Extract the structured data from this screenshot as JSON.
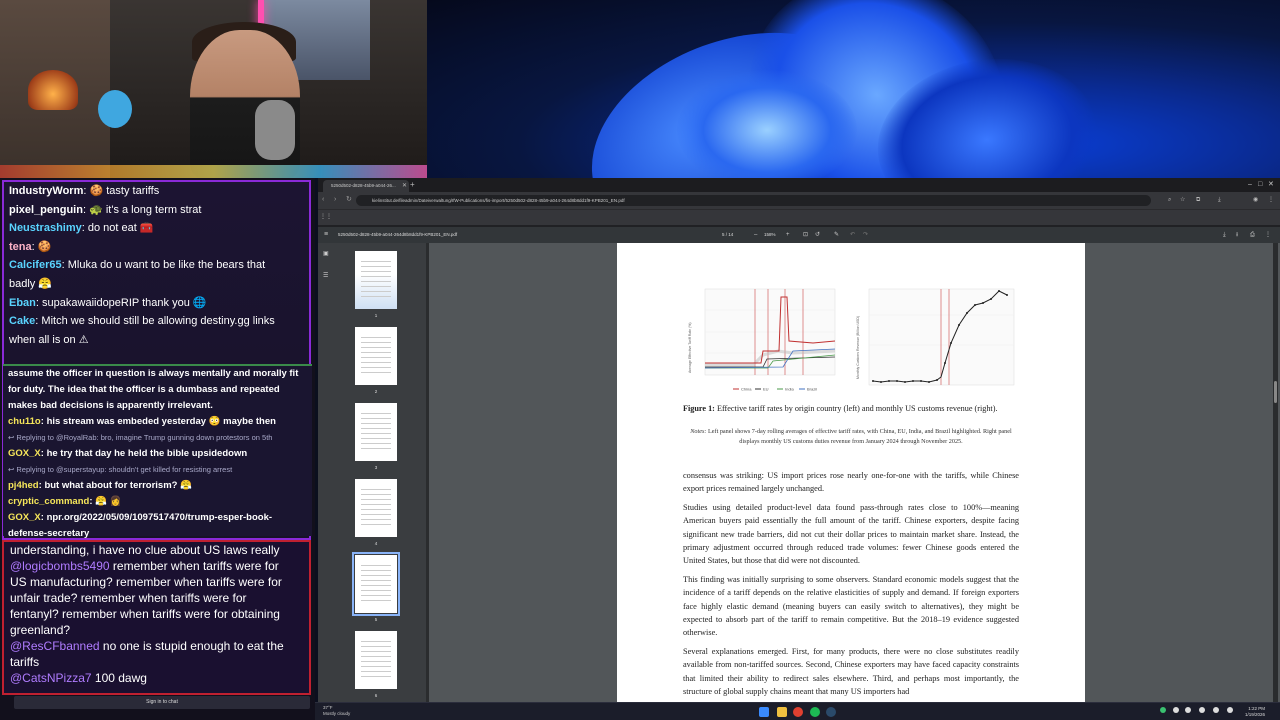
{
  "chat": {
    "upper_messages": [
      {
        "user": "IndustryWorm",
        "color": "#ffffff",
        "text": "🍪 tasty tariffs"
      },
      {
        "user": "pixel_penguin",
        "color": "#ffffff",
        "text": "🐢 it's a long term strat"
      },
      {
        "user": "Neustrashimy",
        "color": "#5ad4ff",
        "text": "do not eat 🧰"
      },
      {
        "user": "tena",
        "color": "#ffb4c8",
        "text": "🍪"
      },
      {
        "user": "Calcifer65",
        "color": "#5ad4ff",
        "text": "Mluka do u want to be like the bears that"
      },
      {
        "user": "",
        "color": "#ffffff",
        "text": "badly 😤"
      },
      {
        "user": "Eban",
        "color": "#5ad4ff",
        "text": "supakawaiidopeRIP thank you 🌐"
      },
      {
        "user": "Cake",
        "color": "#5ad4ff",
        "text": "Mitch we should still be allowing destiny.gg links"
      },
      {
        "user": "",
        "color": "#ffffff",
        "text": "when all is on ⚠"
      }
    ],
    "mid_messages": [
      {
        "user": "",
        "text": "assume the officer in question is always mentally and morally fit",
        "reply": false
      },
      {
        "user": "",
        "text": "for duty. The idea that the officer is a dumbass and repeated",
        "reply": false
      },
      {
        "user": "",
        "text": "makes bad decisions is apparently irrelevant.",
        "reply": false
      },
      {
        "user": "chu11o",
        "text": "his stream was embeded yesterday 😳 maybe then",
        "reply": false
      },
      {
        "user": "",
        "text": "↩ Replying to @RoyalRab: bro, imagine Trump gunning down protestors on 5th",
        "reply": true
      },
      {
        "user": "GOX_X",
        "text": "he try that day he held the bible upsidedown",
        "reply": false
      },
      {
        "user": "",
        "text": "↩ Replying to @superstayup: shouldn't get killed for resisting arrest",
        "reply": true
      },
      {
        "user": "pj4hed",
        "text": "but what about for terrorism? 😤",
        "reply": false
      },
      {
        "user": "cryptic_command",
        "text": "😤 👩",
        "reply": false
      },
      {
        "user": "GOX_X",
        "text": "npr.org/2022/05/09/1097517470/trump-esper-book-",
        "reply": false
      },
      {
        "user": "",
        "text": "defense-secretary",
        "reply": false
      }
    ],
    "lower_lines": [
      {
        "user": "",
        "text": "understanding, i have no clue about US laws really"
      },
      {
        "user": "@logicbombs5490",
        "text": "remember when tariffs were for"
      },
      {
        "user": "",
        "text": "US manufacturing? remember when tariffs were for"
      },
      {
        "user": "",
        "text": "unfair trade? remember when tariffs were for"
      },
      {
        "user": "",
        "text": "fentanyl? remember when tariffs were for obtaining"
      },
      {
        "user": "",
        "text": "greenland?"
      },
      {
        "user": "@ResCFbanned",
        "text": "no one is stupid enough to eat the"
      },
      {
        "user": "",
        "text": "tariffs"
      },
      {
        "user": "@CatsNPizza7",
        "text": "100 dawg"
      }
    ],
    "sign_in": "Sign in to chat"
  },
  "browser": {
    "tab_title": "5250d502-d828-45b9-a044-26...",
    "url": "kielinstitut.de/fileadmin/Dateiverwaltung/IfW-Publications/fis-import/5250d502-d828-45b9-a044-264d8b8dd1f9-KPB201_EN.pdf",
    "pdf_filename": "5250d502-d828-45b9-a044-264d8b8dd1f9-KPB201_EN.pdf",
    "page_current": "5",
    "page_total": "/ 14",
    "zoom": "158%",
    "thumb_numbers": [
      "1",
      "2",
      "3",
      "4",
      "5",
      "6"
    ]
  },
  "pdf": {
    "caption_label": "Figure 1:",
    "caption_text": "Effective tariff rates by origin country (left) and monthly US customs revenue (right).",
    "notes_label": "Notes:",
    "notes_text": "Left panel shows 7-day rolling averages of effective tariff rates, with China, EU, India, and Brazil highlighted. Right panel displays monthly US customs duties revenue from January 2024 through November 2025.",
    "para1": "consensus was striking: US import prices rose nearly one-for-one with the tariffs, while Chinese export prices remained largely unchanged.",
    "para2": "Studies using detailed product-level data found pass-through rates close to 100%—meaning American buyers paid essentially the full amount of the tariff. Chinese exporters, despite facing significant new trade barriers, did not cut their dollar prices to maintain market share. Instead, the primary adjustment occurred through reduced trade volumes: fewer Chinese goods entered the United States, but those that did were not discounted.",
    "para3": "This finding was initially surprising to some observers. Standard economic models suggest that the incidence of a tariff depends on the relative elasticities of supply and demand. If foreign exporters face highly elastic demand (meaning buyers can easily switch to alternatives), they might be expected to absorb part of the tariff to remain competitive. But the 2018–19 evidence suggested otherwise.",
    "para4": "Several explanations emerged. First, for many products, there were no close substitutes readily available from non-tariffed sources. Second, Chinese exporters may have faced capacity constraints that limited their ability to redirect sales elsewhere. Third, and perhaps most importantly, the structure of global supply chains meant that many US importers had",
    "left_ylabel": "Average Effective Tariff Rate (%)",
    "right_ylabel": "Monthly Customs Revenue (Billion USD)",
    "left_legend": [
      "China",
      "EU",
      "India",
      "Brazil"
    ]
  },
  "taskbar": {
    "weather_temp": "37°F",
    "weather_desc": "Mostly cloudy",
    "time": "1:22 PM",
    "date": "1/19/2026"
  }
}
